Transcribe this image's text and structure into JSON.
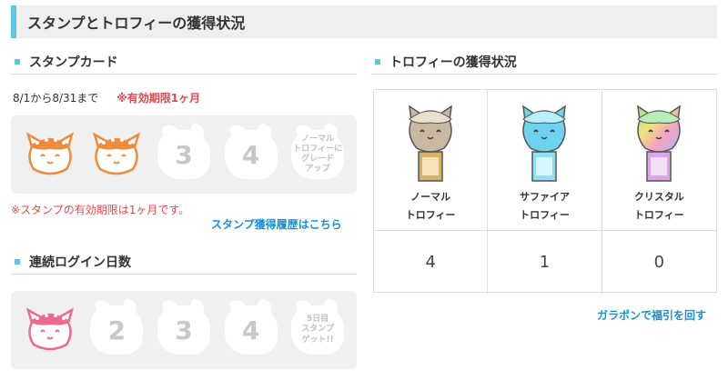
{
  "page": {
    "title": "スタンプとトロフィーの獲得状況"
  },
  "stamp_card": {
    "heading": "スタンプカード",
    "period": "8/1から8/31まで",
    "validity_note": "※有効期限1ヶ月",
    "slots": [
      {
        "type": "stamp",
        "icon": "orange-cat-stamp-icon"
      },
      {
        "type": "stamp",
        "icon": "orange-cat-stamp-icon"
      },
      {
        "type": "empty",
        "label": "3"
      },
      {
        "type": "empty",
        "label": "4"
      },
      {
        "type": "reward",
        "label": "ノーマル\nトロフィーに\nグレード\nアップ"
      }
    ],
    "footnote": "※スタンプの有効期限は1ヶ月です。",
    "history_link": "スタンプ獲得履歴はこちら"
  },
  "login_streak": {
    "heading": "連続ログイン日数",
    "slots": [
      {
        "type": "stamp",
        "icon": "pink-cat-stamp-icon"
      },
      {
        "type": "empty",
        "label": "2"
      },
      {
        "type": "empty",
        "label": "3"
      },
      {
        "type": "empty",
        "label": "4"
      },
      {
        "type": "reward",
        "label": "5日目\nスタンプ\nゲット!!"
      }
    ]
  },
  "trophies": {
    "heading": "トロフィーの獲得状況",
    "items": [
      {
        "name_line1": "ノーマル",
        "name_line2": "トロフィー",
        "count": "4",
        "color": "#c9b9a0",
        "base": "#d4b26a",
        "icon": "normal-trophy-icon"
      },
      {
        "name_line1": "サファイア",
        "name_line2": "トロフィー",
        "count": "1",
        "color": "#6fd3f0",
        "base": "#8fe0f5",
        "icon": "sapphire-trophy-icon"
      },
      {
        "name_line1": "クリスタル",
        "name_line2": "トロフィー",
        "count": "0",
        "color": "#e6a0c8",
        "base": "#d9a6e6",
        "icon": "crystal-trophy-icon"
      }
    ],
    "gacha_link": "ガラポンで福引を回す"
  },
  "colors": {
    "accent": "#5bc8e2",
    "warning_red": "#e8474f",
    "link_blue": "#1a8fd8",
    "stamp_orange": "#f08a3c",
    "stamp_pink": "#ee6a8a"
  }
}
